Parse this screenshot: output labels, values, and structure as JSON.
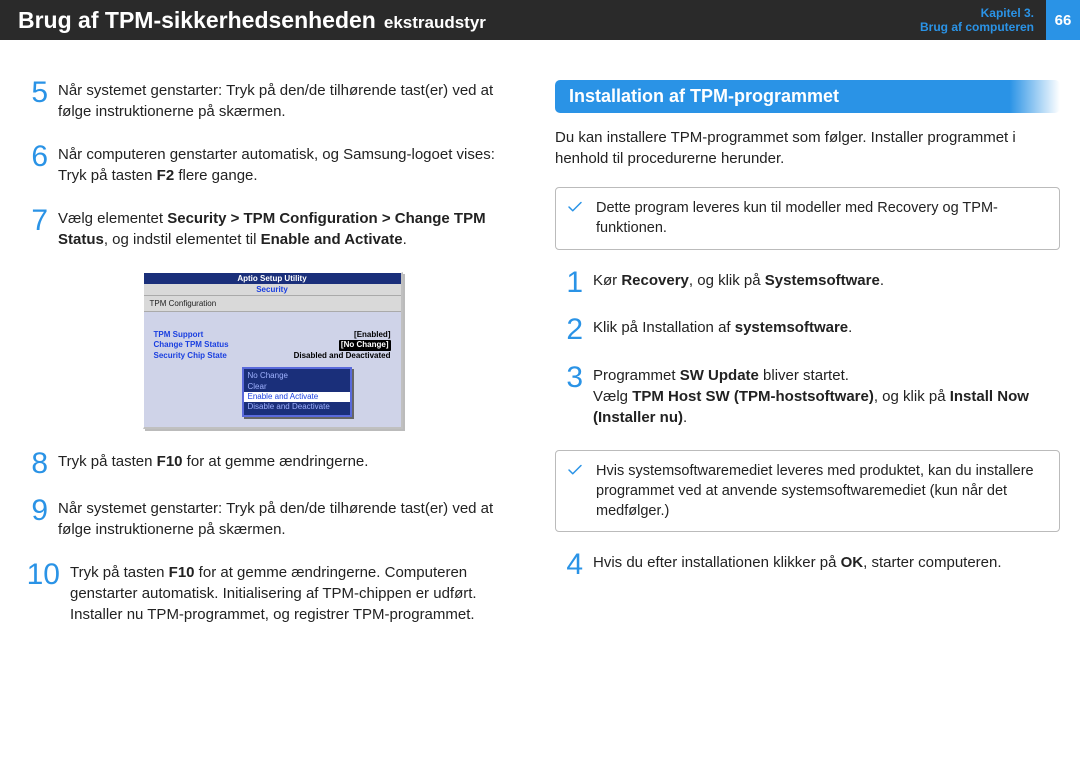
{
  "header": {
    "title_main": "Brug af TPM-sikkerhedsenheden",
    "title_sub": "ekstraudstyr",
    "chapter_line1": "Kapitel 3.",
    "chapter_line2": "Brug af computeren",
    "page_number": "66"
  },
  "left_steps": {
    "s5": "Når systemet genstarter: Tryk på den/de tilhørende tast(er) ved at følge instruktionerne på skærmen.",
    "s6": "Når computeren genstarter automatisk, og Samsung-logoet vises: Tryk på tasten <b>F2</b> flere gange.",
    "s7": "Vælg elementet <b>Security > TPM Configuration > Change TPM Status</b>, og indstil elementet til <b>Enable and Activate</b>.",
    "s8": "Tryk på tasten <b>F10</b> for at gemme ændringerne.",
    "s9": "Når systemet genstarter: Tryk på den/de tilhørende tast(er) ved at følge instruktionerne på skærmen.",
    "s10": "Tryk på tasten <b>F10</b> for at gemme ændringerne. Computeren genstarter automatisk. Initialisering af TPM-chippen er udført. Installer nu TPM-programmet, og registrer TPM-programmet."
  },
  "bios": {
    "window_title": "Aptio Setup Utility",
    "tab": "Security",
    "subhead": "TPM Configuration",
    "rows": [
      {
        "label": "TPM Support",
        "value": "Enabled"
      },
      {
        "label": "Change TPM Status",
        "value": "No Change"
      },
      {
        "label": "Security Chip State",
        "value": "Disabled and Deactivated"
      }
    ],
    "popup": [
      "No Change",
      "Clear",
      "Enable and Activate",
      "Disable and Deactivate"
    ],
    "popup_selected": "Enable and Activate"
  },
  "right": {
    "section_heading": "Installation af TPM-programmet",
    "intro": "Du kan installere TPM-programmet som følger. Installer programmet i henhold til procedurerne herunder.",
    "note_top": "Dette program leveres kun til modeller med Recovery og TPM-funktionen.",
    "s1": "Kør <b>Recovery</b>, og klik på <b>Systemsoftware</b>.",
    "s2": "Klik på Installation af <b>systemsoftware</b>.",
    "s3": "Programmet <b>SW Update</b> bliver startet.<br>Vælg <b>TPM Host SW (TPM-hostsoftware)</b>, og klik på <b>Install Now (Installer nu)</b>.",
    "note_mid": "Hvis systemsoftwaremediet leveres med produktet, kan du installere programmet ved at anvende systemsoftwaremediet (kun når det medfølger.)",
    "s4": "Hvis du efter installationen klikker på <b>OK</b>, starter computeren."
  }
}
